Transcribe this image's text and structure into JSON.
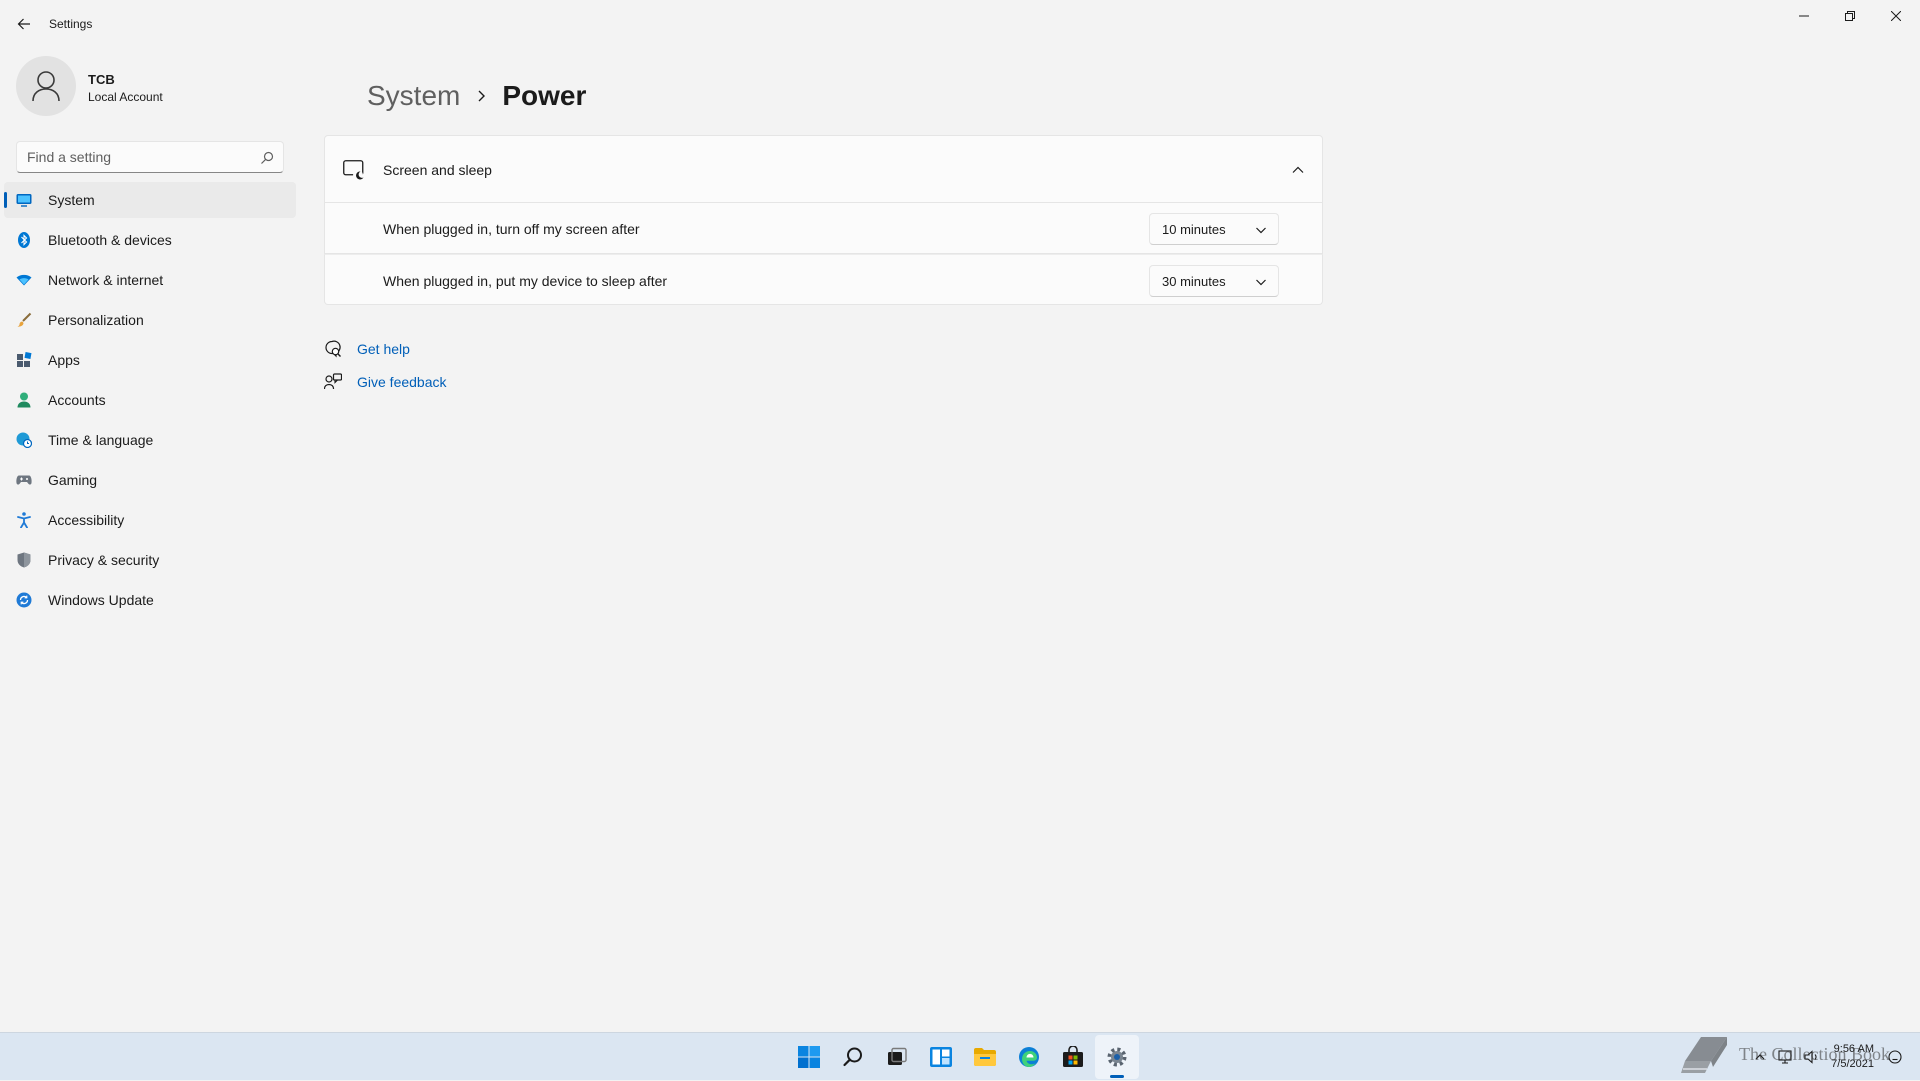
{
  "window": {
    "title": "Settings",
    "controls": [
      "minimize",
      "restore",
      "close"
    ]
  },
  "profile": {
    "name": "TCB",
    "account_type": "Local Account"
  },
  "search": {
    "placeholder": "Find a setting",
    "value": ""
  },
  "sidebar": {
    "items": [
      {
        "label": "System",
        "icon": "system-icon",
        "color": "#0067c0",
        "active": true
      },
      {
        "label": "Bluetooth & devices",
        "icon": "bluetooth-icon",
        "color": "#0078d4"
      },
      {
        "label": "Network & internet",
        "icon": "wifi-icon",
        "color": "#0078d4"
      },
      {
        "label": "Personalization",
        "icon": "brush-icon",
        "color": "#e8a33c"
      },
      {
        "label": "Apps",
        "icon": "apps-icon",
        "color": "#4a5a6e"
      },
      {
        "label": "Accounts",
        "icon": "accounts-icon",
        "color": "#2fae7a"
      },
      {
        "label": "Time & language",
        "icon": "globe-clock-icon",
        "color": "#1f9ad6"
      },
      {
        "label": "Gaming",
        "icon": "gamepad-icon",
        "color": "#6e7680"
      },
      {
        "label": "Accessibility",
        "icon": "accessibility-icon",
        "color": "#1f7ad6"
      },
      {
        "label": "Privacy & security",
        "icon": "shield-icon",
        "color": "#6e7680"
      },
      {
        "label": "Windows Update",
        "icon": "update-icon",
        "color": "#1f7ad6"
      }
    ]
  },
  "breadcrumb": {
    "parent": "System",
    "current": "Power"
  },
  "screen_and_sleep": {
    "title": "Screen and sleep",
    "expanded": true,
    "rows": [
      {
        "label": "When plugged in, turn off my screen after",
        "value": "10 minutes"
      },
      {
        "label": "When plugged in, put my device to sleep after",
        "value": "30 minutes"
      }
    ]
  },
  "links": {
    "help": "Get help",
    "feedback": "Give feedback"
  },
  "taskbar": {
    "apps": [
      "start-icon",
      "search-icon",
      "task-view-icon",
      "widgets-icon",
      "file-explorer-icon",
      "edge-icon",
      "store-icon",
      "settings-icon"
    ],
    "active_app": "settings-icon",
    "time": "9:56 AM",
    "date": "7/5/2021"
  },
  "watermark": {
    "text": "The Collection Book"
  },
  "colors": {
    "accent": "#005fb8",
    "background": "#f3f3f3",
    "card": "#fbfbfb",
    "taskbar": "#dbe6f2"
  }
}
